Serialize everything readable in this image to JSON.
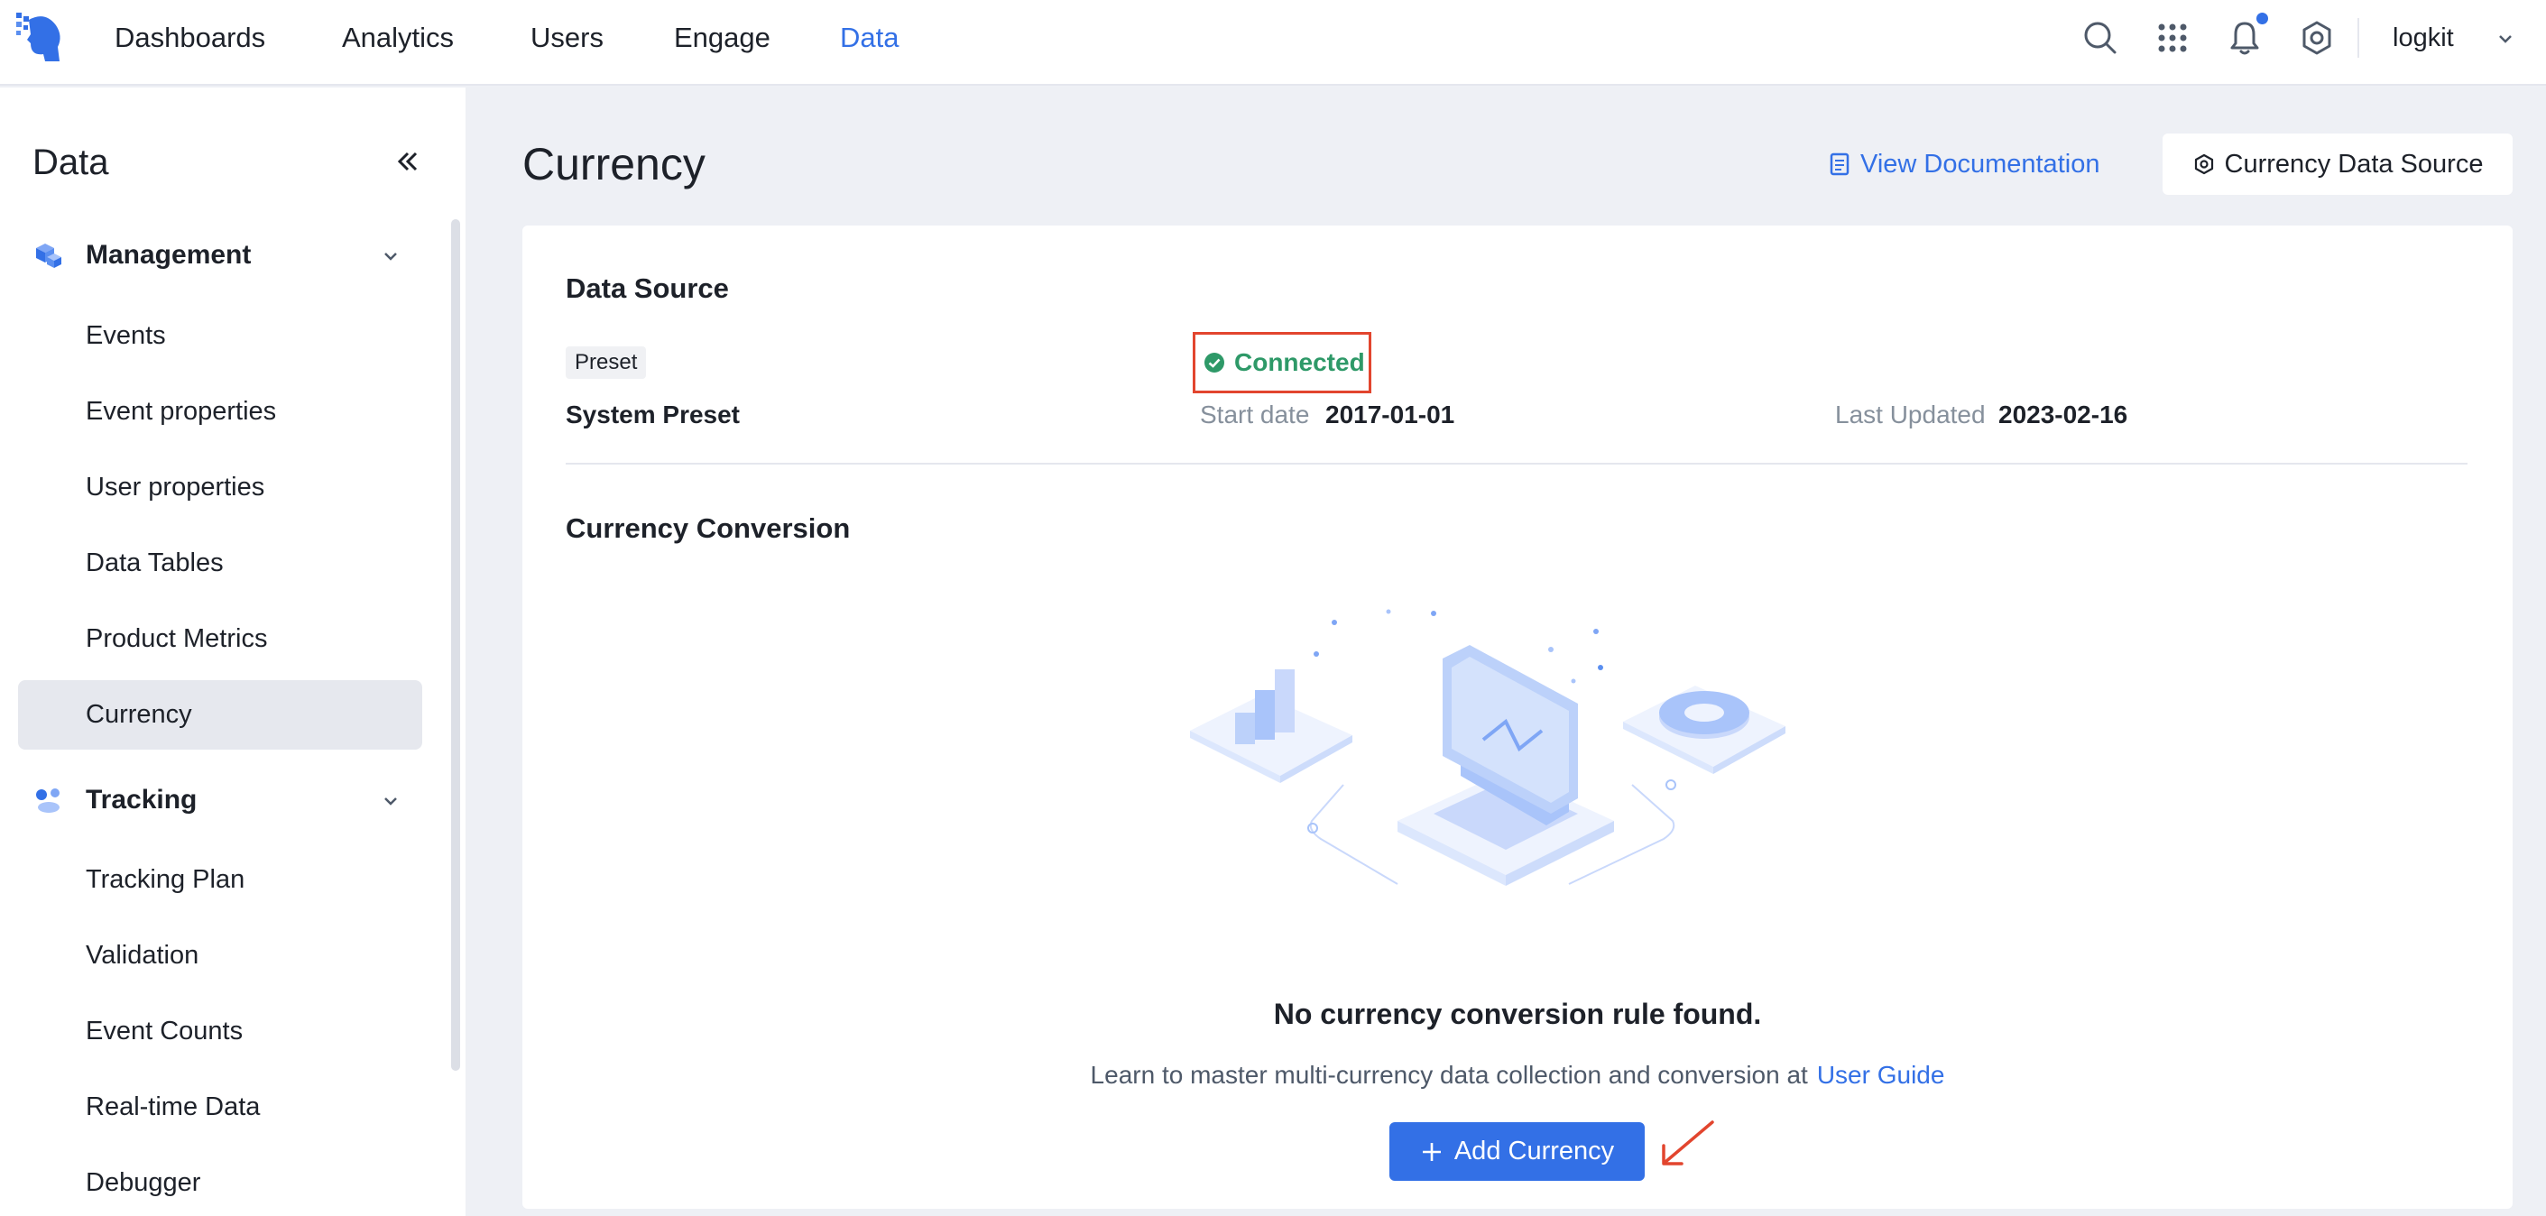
{
  "topnav": {
    "items": [
      {
        "label": "Dashboards"
      },
      {
        "label": "Analytics"
      },
      {
        "label": "Users"
      },
      {
        "label": "Engage"
      },
      {
        "label": "Data",
        "active": true
      }
    ],
    "user": "logkit",
    "accent_color": "#3370e6"
  },
  "sidebar": {
    "title": "Data",
    "groups": [
      {
        "label": "Management",
        "items": [
          "Events",
          "Event properties",
          "User properties",
          "Data Tables",
          "Product Metrics",
          "Currency"
        ]
      },
      {
        "label": "Tracking",
        "items": [
          "Tracking Plan",
          "Validation",
          "Event Counts",
          "Real-time Data",
          "Debugger"
        ]
      }
    ],
    "active_item": "Currency"
  },
  "header": {
    "title": "Currency",
    "doc_link": "View Documentation",
    "source_button": "Currency Data Source"
  },
  "data_source": {
    "section_title": "Data Source",
    "tag": "Preset",
    "name": "System Preset",
    "status": "Connected",
    "status_color": "#2e9968",
    "start_date_label": "Start date",
    "start_date": "2017-01-01",
    "last_updated_label": "Last Updated",
    "last_updated": "2023-02-16"
  },
  "conversion": {
    "section_title": "Currency Conversion",
    "empty_title": "No currency conversion rule found.",
    "empty_desc": "Learn to master multi-currency data collection and conversion at",
    "guide_link": "User Guide",
    "add_button": "Add Currency"
  }
}
